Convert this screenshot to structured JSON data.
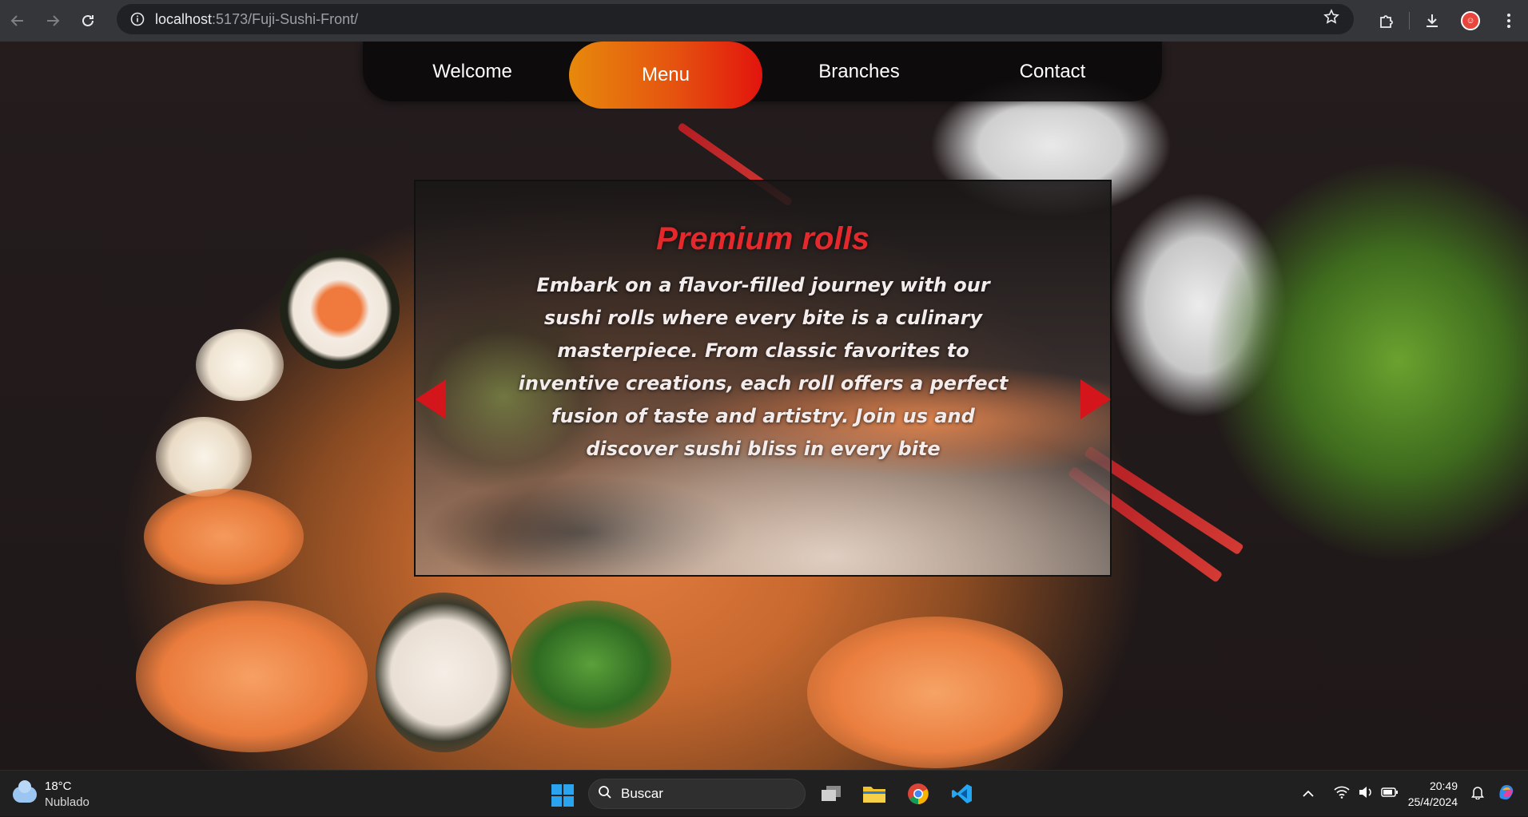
{
  "browser": {
    "url_host": "localhost",
    "url_path": ":5173/Fuji-Sushi-Front/"
  },
  "nav": {
    "tabs": [
      {
        "label": "Welcome",
        "active": false
      },
      {
        "label": "Menu",
        "active": true
      },
      {
        "label": "Branches",
        "active": false
      },
      {
        "label": "Contact",
        "active": false
      }
    ],
    "active_gradient": [
      "#e7890c",
      "#e2140e"
    ]
  },
  "carousel": {
    "title": "Premium rolls",
    "text": "Embark on a flavor-filled journey with our sushi rolls where every bite is a culinary masterpiece. From classic favorites to inventive creations, each roll offers a perfect fusion of taste and artistry. Join us and discover sushi bliss in every bite",
    "title_color": "#e4282c",
    "arrow_color": "#d4151b"
  },
  "taskbar": {
    "weather_temp": "18°C",
    "weather_desc": "Nublado",
    "search_placeholder": "Buscar",
    "time": "20:49",
    "date": "25/4/2024"
  }
}
